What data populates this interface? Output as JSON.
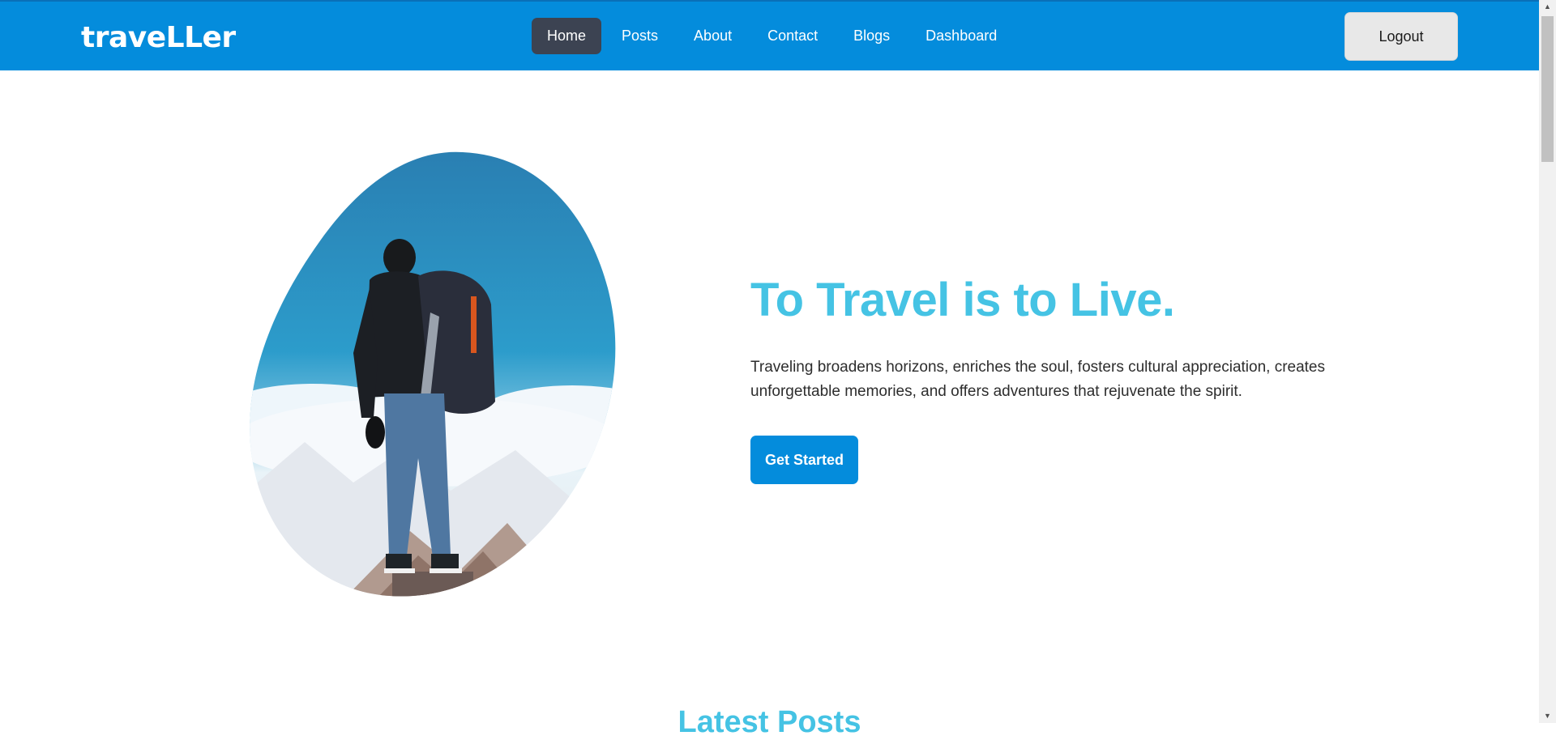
{
  "brand": {
    "name": "traveLLer"
  },
  "nav": {
    "items": [
      {
        "label": "Home",
        "active": true
      },
      {
        "label": "Posts",
        "active": false
      },
      {
        "label": "About",
        "active": false
      },
      {
        "label": "Contact",
        "active": false
      },
      {
        "label": "Blogs",
        "active": false
      },
      {
        "label": "Dashboard",
        "active": false
      }
    ],
    "logout_label": "Logout"
  },
  "hero": {
    "title": "To Travel is to Live.",
    "description": "Traveling broadens horizons, enriches the soul, fosters cultural appreciation, creates unforgettable memories, and offers adventures that rejuvenate the spirit.",
    "cta_label": "Get Started"
  },
  "latest": {
    "title": "Latest Posts"
  },
  "colors": {
    "nav_bg": "#048cdc",
    "accent": "#45c3e4",
    "active_tab": "#3c4352",
    "logout_bg": "#e8e8e8"
  },
  "scrollbar": {
    "up_icon": "scroll-up-arrow-icon",
    "down_icon": "scroll-down-arrow-icon"
  }
}
